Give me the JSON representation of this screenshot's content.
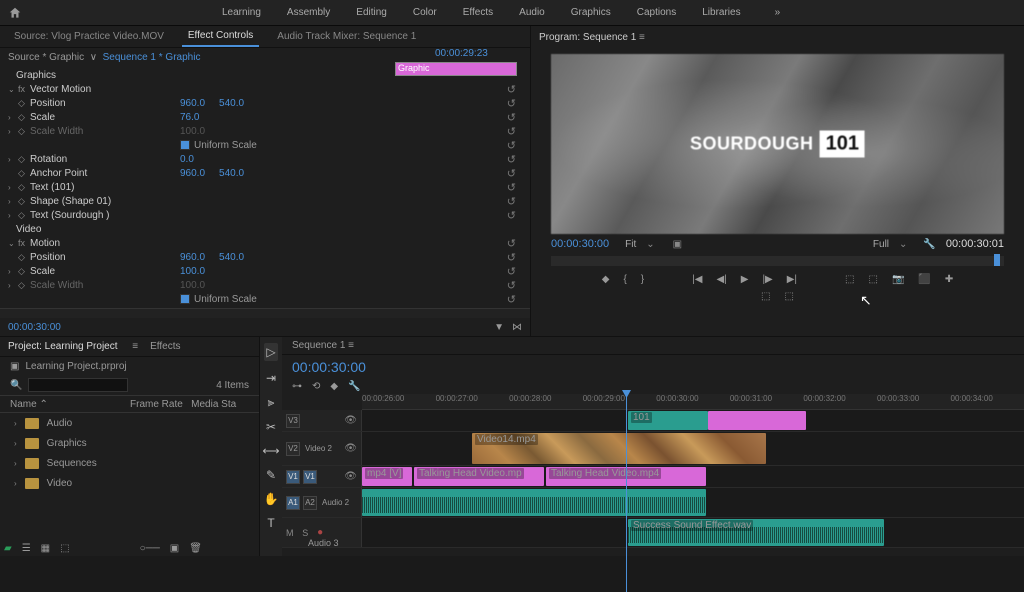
{
  "workspaces": {
    "w1": "Learning",
    "w2": "Assembly",
    "w3": "Editing",
    "w4": "Color",
    "w5": "Effects",
    "w6": "Audio",
    "w7": "Graphics",
    "w8": "Captions",
    "w9": "Libraries",
    "more": "»"
  },
  "source_tabs": {
    "t1": "Source: Vlog Practice Video.MOV",
    "t2": "Effect Controls",
    "t3": "Audio Track Mixer: Sequence 1"
  },
  "breadcrumb": {
    "seg1": "Source * Graphic",
    "sep": "∨",
    "seg2": "Sequence 1 * Graphic"
  },
  "ec_timecode": "00:00:29:23",
  "ec_cliplabel": "Graphic",
  "ec": {
    "graphics": "Graphics",
    "vector": "Vector Motion",
    "position": "Position",
    "pos_x": "960.0",
    "pos_y": "540.0",
    "scale": "Scale",
    "scale_v": "76.0",
    "scalew": "Scale Width",
    "scalew_v": "100.0",
    "uniform": "Uniform Scale",
    "rotation": "Rotation",
    "rotation_v": "0.0",
    "anchor": "Anchor Point",
    "ax": "960.0",
    "ay": "540.0",
    "text1": "Text (101)",
    "shape": "Shape (Shape 01)",
    "text2": "Text (Sourdough )",
    "video": "Video",
    "motion": "Motion",
    "mpos_x": "960.0",
    "mpos_y": "540.0",
    "mscale_v": "100.0"
  },
  "program": {
    "tab": "Program: Sequence 1",
    "title1": "SOURDOUGH",
    "title2": "101",
    "tc": "00:00:30:00",
    "fit": "Fit",
    "full": "Full",
    "dur": "00:00:30:01"
  },
  "tc_bottom": "00:00:30:00",
  "project": {
    "tab1": "Project: Learning Project",
    "tab2": "Effects",
    "file": "Learning Project.prproj",
    "count": "4 Items",
    "col1": "Name",
    "col2": "Frame Rate",
    "col3": "Media Sta",
    "bins": [
      "Audio",
      "Graphics",
      "Sequences",
      "Video"
    ]
  },
  "timeline": {
    "tab": "Sequence 1",
    "tc": "00:00:30:00",
    "marks": [
      "00:00:26:00",
      "00:00:27:00",
      "00:00:28:00",
      "00:00:29:00",
      "00:00:30:00",
      "00:00:31:00",
      "00:00:32:00",
      "00:00:33:00",
      "00:00:34:00"
    ],
    "tracks": {
      "v3": "V3",
      "v2": "V2",
      "v1": "V1",
      "a1": "A1",
      "a2": "A2",
      "a3": "Audio 3",
      "vid2": "Video 2",
      "aud2": "Audio 2"
    },
    "clips": {
      "c101": "101",
      "vid14": "Video14.mp4",
      "talk1": "mp4 [V]",
      "talk2": "Talking Head Video.mp",
      "talk3": "Talking Head Video.mp4",
      "sfx": "Success Sound Effect.wav"
    }
  }
}
